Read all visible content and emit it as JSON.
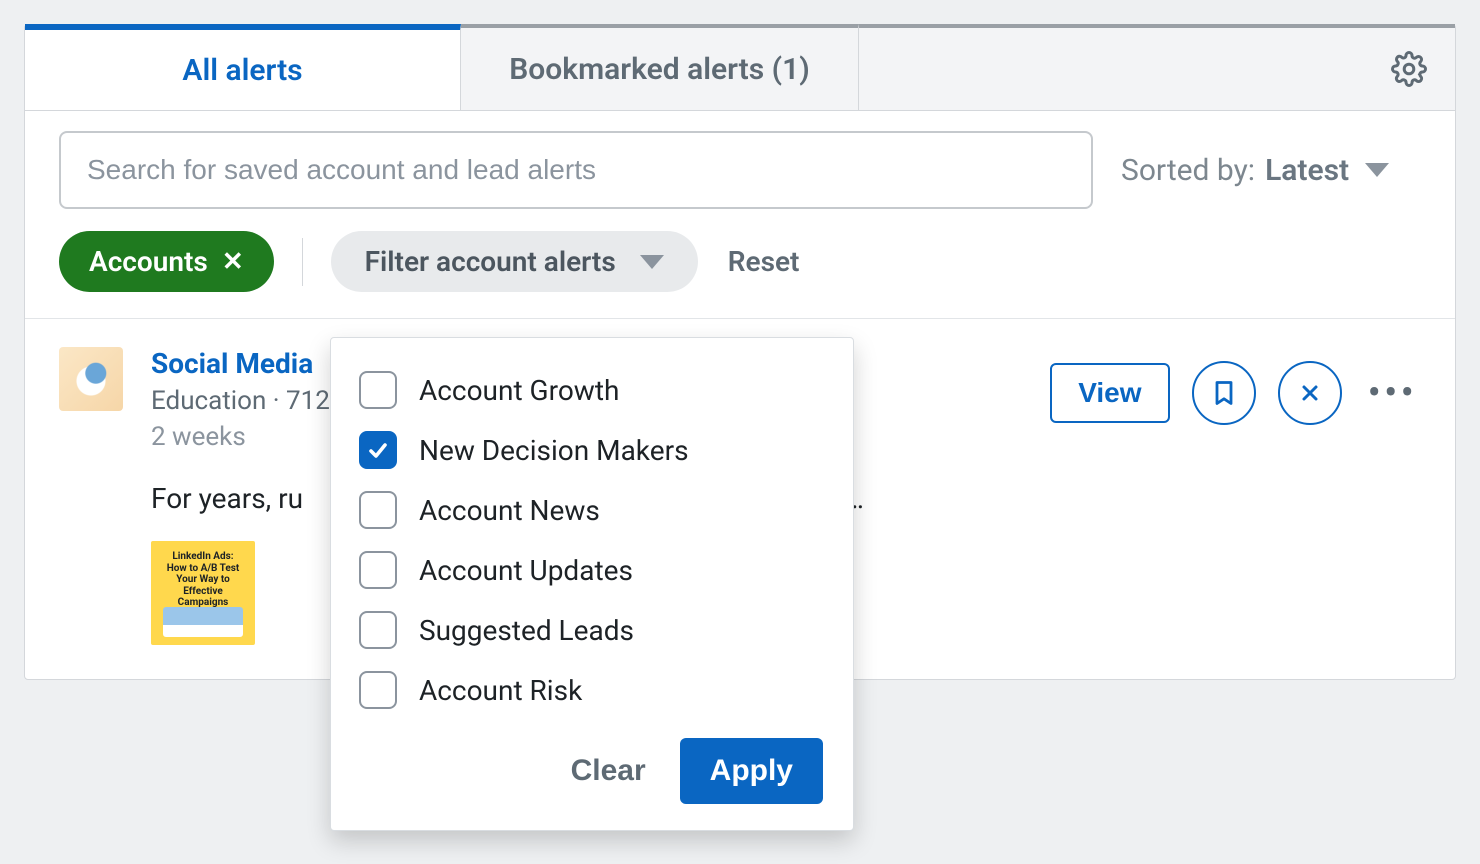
{
  "tabs": {
    "all_alerts": "All alerts",
    "bookmarked": "Bookmarked alerts (1)"
  },
  "search": {
    "placeholder": "Search for saved account and lead alerts"
  },
  "sort": {
    "label": "Sorted by:",
    "value": "Latest"
  },
  "chips": {
    "accounts": "Accounts",
    "filter": "Filter account alerts",
    "reset": "Reset"
  },
  "filter_options": [
    {
      "label": "Account Growth",
      "checked": false
    },
    {
      "label": "New Decision Makers",
      "checked": true
    },
    {
      "label": "Account News",
      "checked": false
    },
    {
      "label": "Account Updates",
      "checked": false
    },
    {
      "label": "Suggested Leads",
      "checked": false
    },
    {
      "label": "Account Risk",
      "checked": false
    }
  ],
  "popover_actions": {
    "clear": "Clear",
    "apply": "Apply"
  },
  "alert": {
    "title": "Social Media",
    "meta": "Education · 712",
    "ago": "2 weeks",
    "snippet_left": "For years, ru",
    "snippet_right": "n't…",
    "thumb_lines": [
      "LinkedIn Ads:",
      "How to A/B Test",
      "Your Way to",
      "Effective Campaigns"
    ]
  },
  "actions": {
    "view": "View"
  }
}
